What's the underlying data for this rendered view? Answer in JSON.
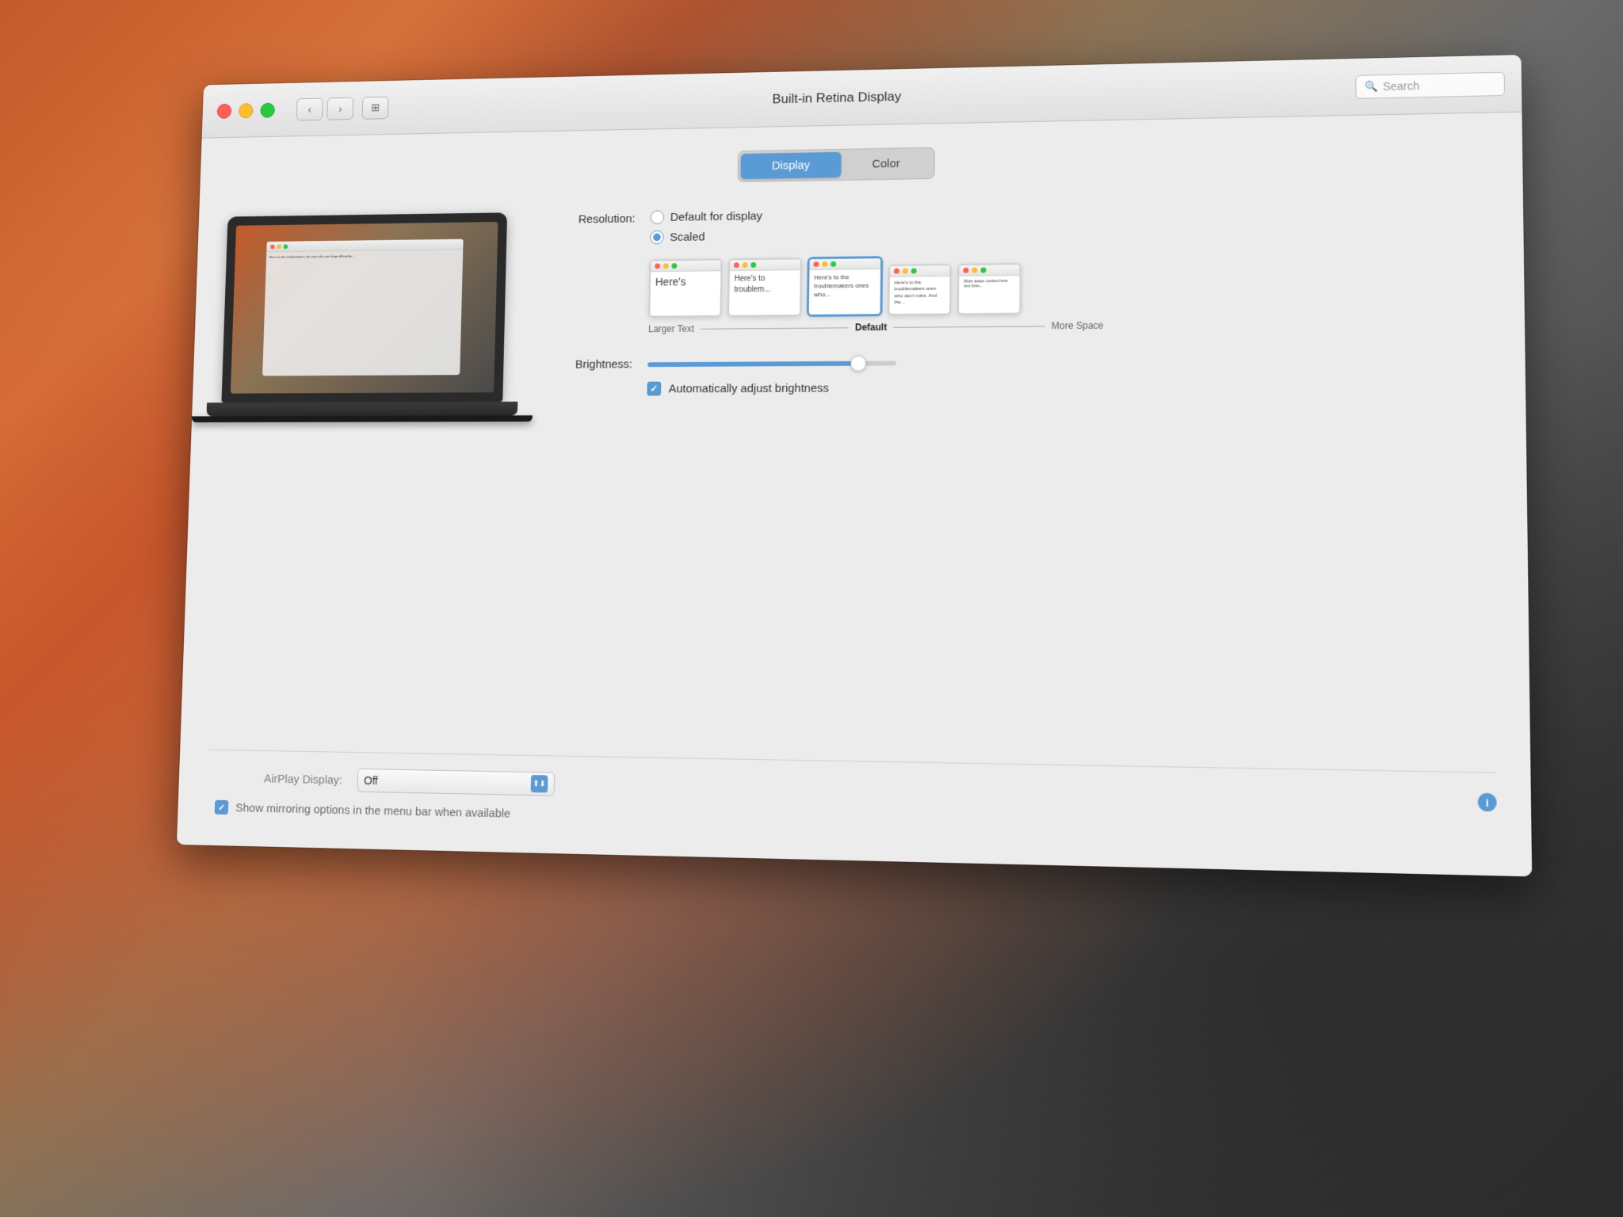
{
  "background": {
    "colors": [
      "#c45a2a",
      "#d4703a",
      "#8b7355",
      "#5a5a5a",
      "#2d2d2d"
    ]
  },
  "window": {
    "title": "Built-in Retina Display",
    "search_placeholder": "Search",
    "traffic_lights": {
      "close": "close",
      "minimize": "minimize",
      "maximize": "maximize"
    }
  },
  "tabs": {
    "display_label": "Display",
    "color_label": "Color",
    "active": "display"
  },
  "resolution": {
    "label": "Resolution:",
    "option1": "Default for display",
    "option2": "Scaled",
    "selected": "scaled"
  },
  "scale_options": [
    {
      "id": "larger",
      "text": "Here's",
      "selected": false,
      "label": "Larger Text"
    },
    {
      "id": "medium",
      "text": "Here's to troublem",
      "selected": false,
      "label": ""
    },
    {
      "id": "default",
      "text": "Here's to the troublemakers ones who",
      "selected": true,
      "label": "Default"
    },
    {
      "id": "smaller1",
      "text": "Here's to the troublemakers ones who don't rules. And the",
      "selected": false,
      "label": ""
    },
    {
      "id": "smaller2",
      "text": "More space content",
      "selected": false,
      "label": "More Space"
    }
  ],
  "brightness": {
    "label": "Brightness:",
    "value": 85,
    "auto_adjust_label": "Automatically adjust brightness",
    "auto_checked": true
  },
  "airplay": {
    "label": "AirPlay Display:",
    "value": "Off"
  },
  "mirroring": {
    "label": "Show mirroring options in the menu bar when available",
    "checked": true
  },
  "labels": {
    "larger_text": "Larger Text",
    "default": "Default",
    "more_space": "More Space"
  }
}
